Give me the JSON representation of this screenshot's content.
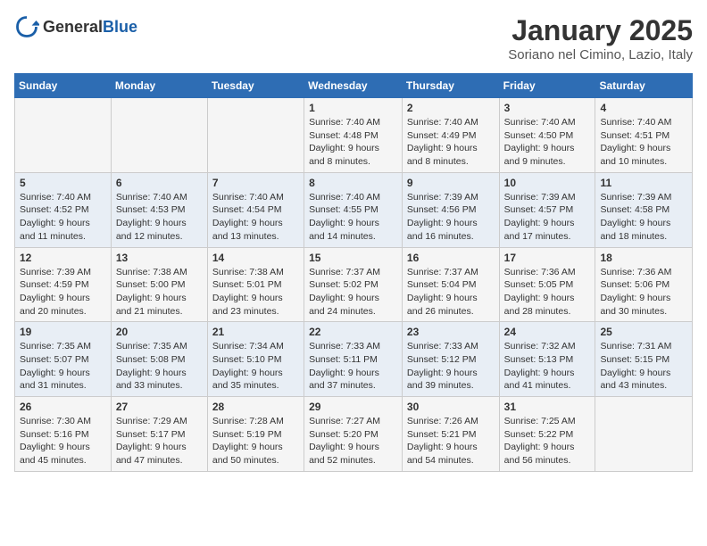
{
  "logo": {
    "general": "General",
    "blue": "Blue"
  },
  "title": "January 2025",
  "subtitle": "Soriano nel Cimino, Lazio, Italy",
  "days_of_week": [
    "Sunday",
    "Monday",
    "Tuesday",
    "Wednesday",
    "Thursday",
    "Friday",
    "Saturday"
  ],
  "weeks": [
    [
      {
        "day": "",
        "info": ""
      },
      {
        "day": "",
        "info": ""
      },
      {
        "day": "",
        "info": ""
      },
      {
        "day": "1",
        "info": "Sunrise: 7:40 AM\nSunset: 4:48 PM\nDaylight: 9 hours and 8 minutes."
      },
      {
        "day": "2",
        "info": "Sunrise: 7:40 AM\nSunset: 4:49 PM\nDaylight: 9 hours and 8 minutes."
      },
      {
        "day": "3",
        "info": "Sunrise: 7:40 AM\nSunset: 4:50 PM\nDaylight: 9 hours and 9 minutes."
      },
      {
        "day": "4",
        "info": "Sunrise: 7:40 AM\nSunset: 4:51 PM\nDaylight: 9 hours and 10 minutes."
      }
    ],
    [
      {
        "day": "5",
        "info": "Sunrise: 7:40 AM\nSunset: 4:52 PM\nDaylight: 9 hours and 11 minutes."
      },
      {
        "day": "6",
        "info": "Sunrise: 7:40 AM\nSunset: 4:53 PM\nDaylight: 9 hours and 12 minutes."
      },
      {
        "day": "7",
        "info": "Sunrise: 7:40 AM\nSunset: 4:54 PM\nDaylight: 9 hours and 13 minutes."
      },
      {
        "day": "8",
        "info": "Sunrise: 7:40 AM\nSunset: 4:55 PM\nDaylight: 9 hours and 14 minutes."
      },
      {
        "day": "9",
        "info": "Sunrise: 7:39 AM\nSunset: 4:56 PM\nDaylight: 9 hours and 16 minutes."
      },
      {
        "day": "10",
        "info": "Sunrise: 7:39 AM\nSunset: 4:57 PM\nDaylight: 9 hours and 17 minutes."
      },
      {
        "day": "11",
        "info": "Sunrise: 7:39 AM\nSunset: 4:58 PM\nDaylight: 9 hours and 18 minutes."
      }
    ],
    [
      {
        "day": "12",
        "info": "Sunrise: 7:39 AM\nSunset: 4:59 PM\nDaylight: 9 hours and 20 minutes."
      },
      {
        "day": "13",
        "info": "Sunrise: 7:38 AM\nSunset: 5:00 PM\nDaylight: 9 hours and 21 minutes."
      },
      {
        "day": "14",
        "info": "Sunrise: 7:38 AM\nSunset: 5:01 PM\nDaylight: 9 hours and 23 minutes."
      },
      {
        "day": "15",
        "info": "Sunrise: 7:37 AM\nSunset: 5:02 PM\nDaylight: 9 hours and 24 minutes."
      },
      {
        "day": "16",
        "info": "Sunrise: 7:37 AM\nSunset: 5:04 PM\nDaylight: 9 hours and 26 minutes."
      },
      {
        "day": "17",
        "info": "Sunrise: 7:36 AM\nSunset: 5:05 PM\nDaylight: 9 hours and 28 minutes."
      },
      {
        "day": "18",
        "info": "Sunrise: 7:36 AM\nSunset: 5:06 PM\nDaylight: 9 hours and 30 minutes."
      }
    ],
    [
      {
        "day": "19",
        "info": "Sunrise: 7:35 AM\nSunset: 5:07 PM\nDaylight: 9 hours and 31 minutes."
      },
      {
        "day": "20",
        "info": "Sunrise: 7:35 AM\nSunset: 5:08 PM\nDaylight: 9 hours and 33 minutes."
      },
      {
        "day": "21",
        "info": "Sunrise: 7:34 AM\nSunset: 5:10 PM\nDaylight: 9 hours and 35 minutes."
      },
      {
        "day": "22",
        "info": "Sunrise: 7:33 AM\nSunset: 5:11 PM\nDaylight: 9 hours and 37 minutes."
      },
      {
        "day": "23",
        "info": "Sunrise: 7:33 AM\nSunset: 5:12 PM\nDaylight: 9 hours and 39 minutes."
      },
      {
        "day": "24",
        "info": "Sunrise: 7:32 AM\nSunset: 5:13 PM\nDaylight: 9 hours and 41 minutes."
      },
      {
        "day": "25",
        "info": "Sunrise: 7:31 AM\nSunset: 5:15 PM\nDaylight: 9 hours and 43 minutes."
      }
    ],
    [
      {
        "day": "26",
        "info": "Sunrise: 7:30 AM\nSunset: 5:16 PM\nDaylight: 9 hours and 45 minutes."
      },
      {
        "day": "27",
        "info": "Sunrise: 7:29 AM\nSunset: 5:17 PM\nDaylight: 9 hours and 47 minutes."
      },
      {
        "day": "28",
        "info": "Sunrise: 7:28 AM\nSunset: 5:19 PM\nDaylight: 9 hours and 50 minutes."
      },
      {
        "day": "29",
        "info": "Sunrise: 7:27 AM\nSunset: 5:20 PM\nDaylight: 9 hours and 52 minutes."
      },
      {
        "day": "30",
        "info": "Sunrise: 7:26 AM\nSunset: 5:21 PM\nDaylight: 9 hours and 54 minutes."
      },
      {
        "day": "31",
        "info": "Sunrise: 7:25 AM\nSunset: 5:22 PM\nDaylight: 9 hours and 56 minutes."
      },
      {
        "day": "",
        "info": ""
      }
    ]
  ]
}
